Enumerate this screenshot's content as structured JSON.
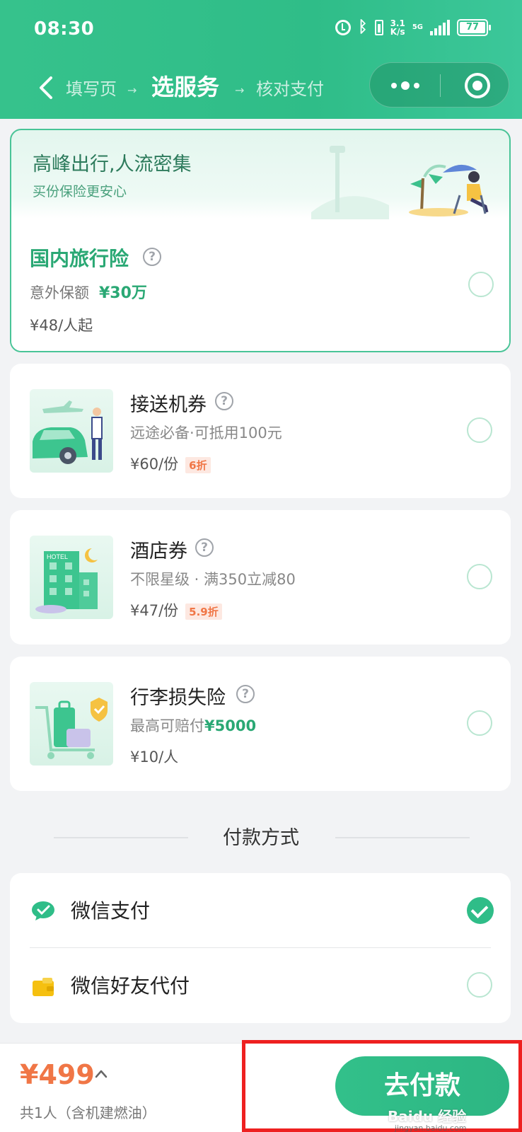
{
  "status_bar": {
    "time": "08:30",
    "speed_top": "3.1",
    "speed_bottom": "K/s",
    "network": "5G",
    "battery": "77",
    "icons": [
      "alarm-icon",
      "bluetooth-icon",
      "battery-saver-icon",
      "signal-icon",
      "battery-icon"
    ]
  },
  "nav": {
    "steps": [
      "填写页",
      "选服务",
      "核对支付"
    ],
    "arrow": "→",
    "current_step_index": 1,
    "icons": [
      "back-icon",
      "more-dots-icon",
      "close-target-icon"
    ]
  },
  "banner": {
    "title": "高峰出行,人流密集",
    "subtitle": "买份保险更安心",
    "insurance": {
      "name": "国内旅行险",
      "coverage_label": "意外保额",
      "coverage_amount": "¥30万",
      "price": "¥48/人起",
      "selected": false
    }
  },
  "services": [
    {
      "name": "接送机券",
      "desc": "远途必备·可抵用100元",
      "price": "¥60/份",
      "discount": "6折",
      "icon": "car-pickup-icon",
      "selected": false
    },
    {
      "name": "酒店券",
      "desc": "不限星级 · 满350立减80",
      "price": "¥47/份",
      "discount": "5.9折",
      "icon": "hotel-icon",
      "image_text": "HOTEL",
      "selected": false
    },
    {
      "name": "行李损失险",
      "desc_label": "最高可赔付",
      "desc_amount": "¥5000",
      "price": "¥10/人",
      "icon": "luggage-icon",
      "selected": false
    }
  ],
  "payment": {
    "section_title": "付款方式",
    "methods": [
      {
        "label": "微信支付",
        "icon": "wechat-pay-icon",
        "selected": true
      },
      {
        "label": "微信好友代付",
        "icon": "wallet-icon",
        "selected": false
      }
    ]
  },
  "footer": {
    "total_price": "¥499",
    "total_note": "共1人（含机建燃油）",
    "pay_button": "去付款"
  },
  "watermark": {
    "text": "Baidu 经验",
    "url": "jingyan.baidu.com"
  },
  "colors": {
    "brand_green": "#2fbd88",
    "price_orange": "#f07646",
    "highlight_red": "#ee2020"
  }
}
